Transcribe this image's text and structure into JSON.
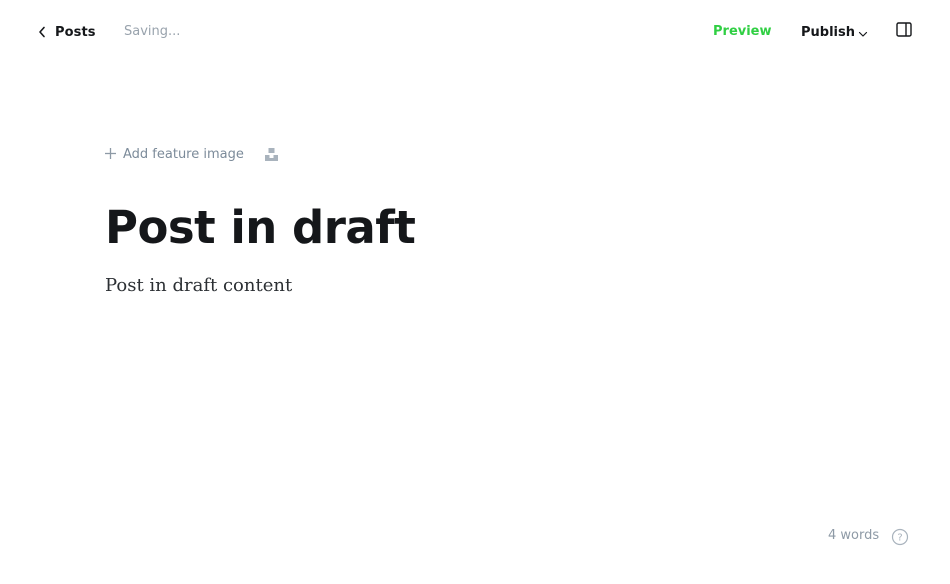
{
  "header": {
    "back_label": "Posts",
    "status": "Saving...",
    "preview_label": "Preview",
    "publish_label": "Publish"
  },
  "editor": {
    "feature_image_label": "Add feature image",
    "title": "Post in draft",
    "body": "Post in draft content"
  },
  "footer": {
    "word_count": "4 words",
    "help_glyph": "?"
  },
  "colors": {
    "accent": "#30cf43",
    "text_dark": "#15171a",
    "text_muted": "#99a3ad"
  },
  "icons": {
    "back": "chevron-left-icon",
    "publish_dropdown": "chevron-down-icon",
    "settings": "sidebar-panel-icon",
    "feature_image": "plus-icon",
    "unsplash": "unsplash-icon",
    "help": "question-circle-icon"
  }
}
